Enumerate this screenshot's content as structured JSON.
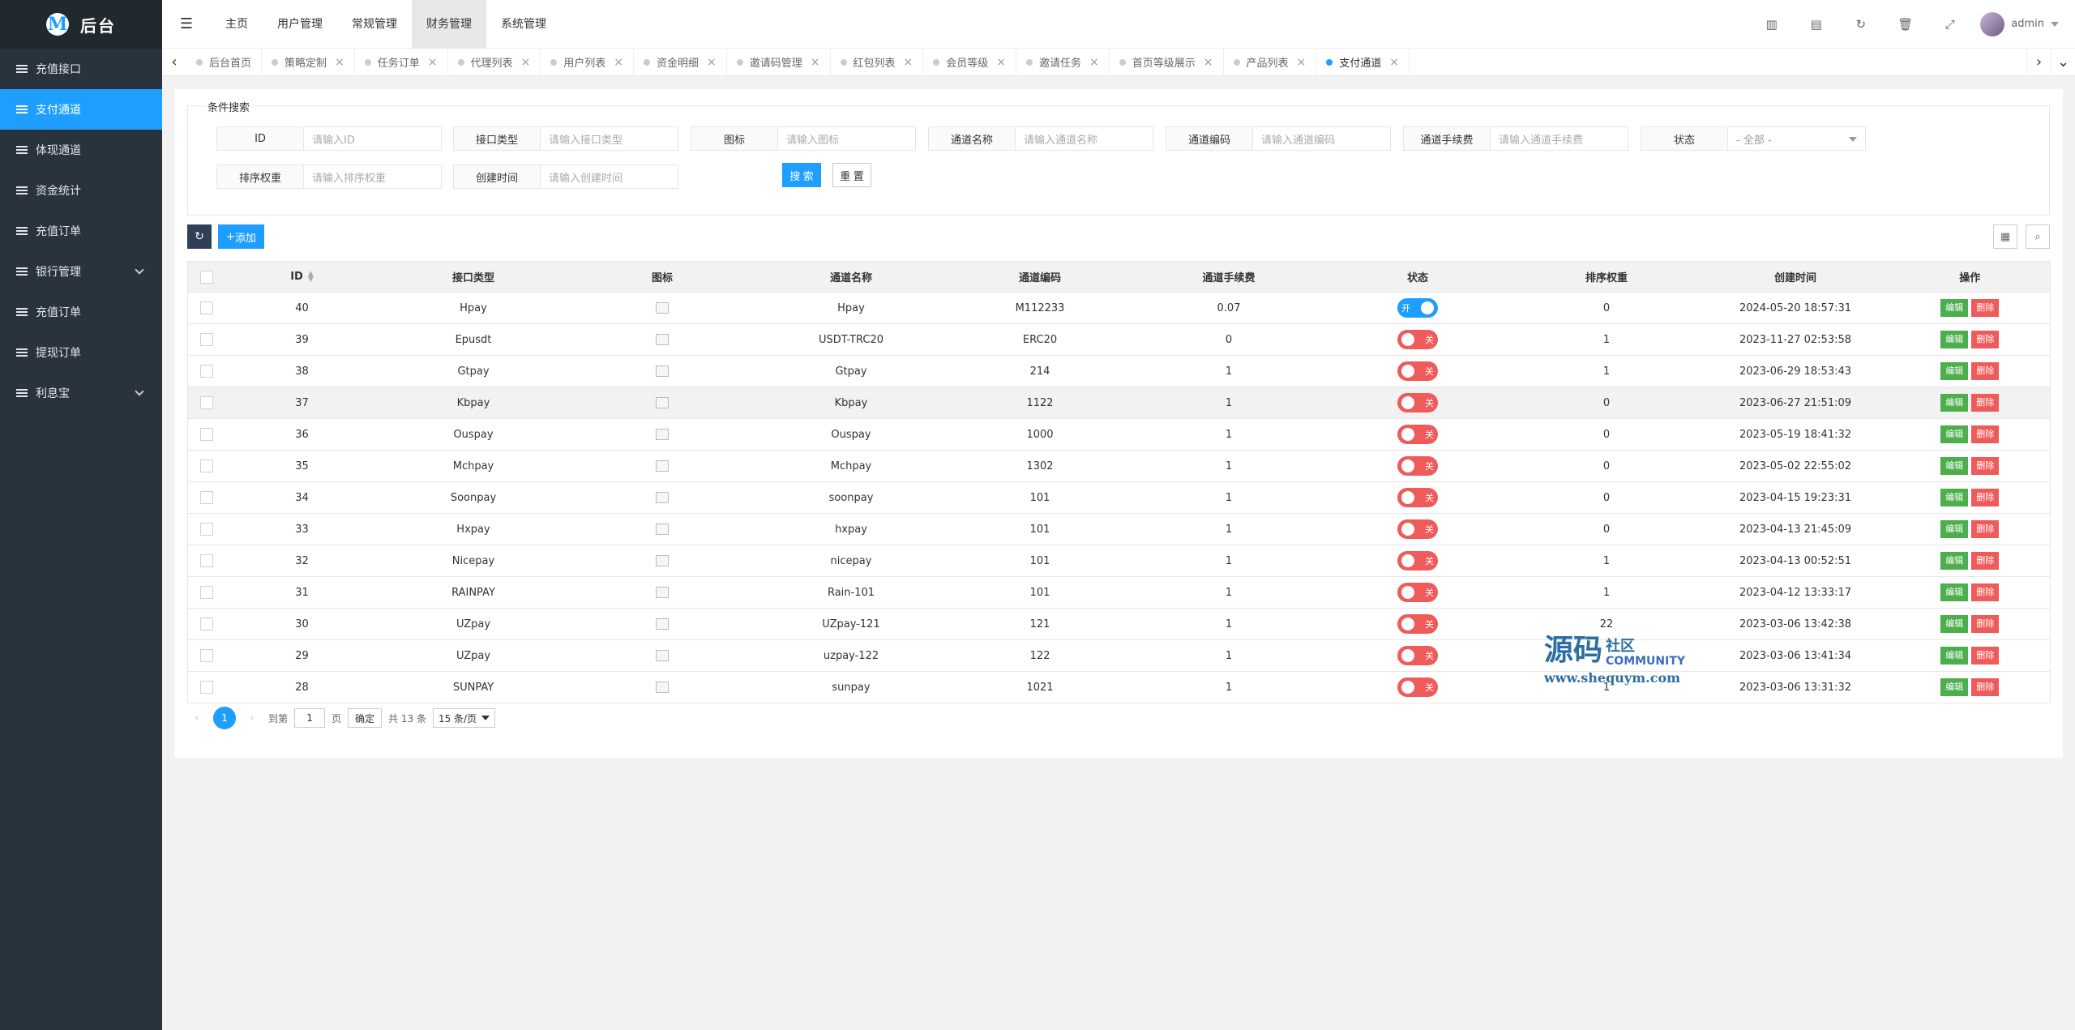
{
  "app": {
    "logo_letter": "M",
    "title": "后台"
  },
  "sidebar": {
    "items": [
      {
        "label": "充值接口",
        "active": false,
        "has_arrow": false
      },
      {
        "label": "支付通道",
        "active": true,
        "has_arrow": false
      },
      {
        "label": "体现通道",
        "active": false,
        "has_arrow": false
      },
      {
        "label": "资金统计",
        "active": false,
        "has_arrow": false
      },
      {
        "label": "充值订单",
        "active": false,
        "has_arrow": false
      },
      {
        "label": "银行管理",
        "active": false,
        "has_arrow": true
      },
      {
        "label": "充值订单",
        "active": false,
        "has_arrow": false
      },
      {
        "label": "提现订单",
        "active": false,
        "has_arrow": false
      },
      {
        "label": "利息宝",
        "active": false,
        "has_arrow": true
      }
    ]
  },
  "header": {
    "nav": [
      "主页",
      "用户管理",
      "常规管理",
      "财务管理",
      "系统管理"
    ],
    "active_nav": 3,
    "username": "admin"
  },
  "tabs": [
    {
      "label": "后台首页",
      "closable": false,
      "active": false
    },
    {
      "label": "策略定制",
      "closable": true,
      "active": false
    },
    {
      "label": "任务订单",
      "closable": true,
      "active": false
    },
    {
      "label": "代理列表",
      "closable": true,
      "active": false
    },
    {
      "label": "用户列表",
      "closable": true,
      "active": false
    },
    {
      "label": "资金明细",
      "closable": true,
      "active": false
    },
    {
      "label": "邀请码管理",
      "closable": true,
      "active": false
    },
    {
      "label": "红包列表",
      "closable": true,
      "active": false
    },
    {
      "label": "会员等级",
      "closable": true,
      "active": false
    },
    {
      "label": "邀请任务",
      "closable": true,
      "active": false
    },
    {
      "label": "首页等级展示",
      "closable": true,
      "active": false
    },
    {
      "label": "产品列表",
      "closable": true,
      "active": false
    },
    {
      "label": "支付通道",
      "closable": true,
      "active": true
    }
  ],
  "search": {
    "legend": "条件搜索",
    "fields": {
      "id": {
        "label": "ID",
        "placeholder": "请输入ID"
      },
      "type": {
        "label": "接口类型",
        "placeholder": "请输入接口类型"
      },
      "icon": {
        "label": "图标",
        "placeholder": "请输入图标"
      },
      "name": {
        "label": "通道名称",
        "placeholder": "请输入通道名称"
      },
      "code": {
        "label": "通道编码",
        "placeholder": "请输入通道编码"
      },
      "fee": {
        "label": "通道手续费",
        "placeholder": "请输入通道手续费"
      },
      "status": {
        "label": "状态",
        "value": "- 全部 -"
      },
      "sort": {
        "label": "排序权重",
        "placeholder": "请输入排序权重"
      },
      "created": {
        "label": "创建时间",
        "placeholder": "请输入创建时间"
      }
    },
    "search_label": "搜 索",
    "reset_label": "重 置"
  },
  "toolbar": {
    "add_label": "添加"
  },
  "table": {
    "headers": [
      "ID",
      "接口类型",
      "图标",
      "通道名称",
      "通道编码",
      "通道手续费",
      "状态",
      "排序权重",
      "创建时间",
      "操作"
    ],
    "edit_label": "编辑",
    "delete_label": "删除",
    "on_label": "开",
    "off_label": "关",
    "rows": [
      {
        "id": "40",
        "type": "Hpay",
        "name": "Hpay",
        "code": "M112233",
        "fee": "0.07",
        "on": true,
        "sort": "0",
        "created": "2024-05-20 18:57:31"
      },
      {
        "id": "39",
        "type": "Epusdt",
        "name": "USDT-TRC20",
        "code": "ERC20",
        "fee": "0",
        "on": false,
        "sort": "1",
        "created": "2023-11-27 02:53:58"
      },
      {
        "id": "38",
        "type": "Gtpay",
        "name": "Gtpay",
        "code": "214",
        "fee": "1",
        "on": false,
        "sort": "1",
        "created": "2023-06-29 18:53:43"
      },
      {
        "id": "37",
        "type": "Kbpay",
        "name": "Kbpay",
        "code": "1122",
        "fee": "1",
        "on": false,
        "sort": "0",
        "created": "2023-06-27 21:51:09"
      },
      {
        "id": "36",
        "type": "Ouspay",
        "name": "Ouspay",
        "code": "1000",
        "fee": "1",
        "on": false,
        "sort": "0",
        "created": "2023-05-19 18:41:32"
      },
      {
        "id": "35",
        "type": "Mchpay",
        "name": "Mchpay",
        "code": "1302",
        "fee": "1",
        "on": false,
        "sort": "0",
        "created": "2023-05-02 22:55:02"
      },
      {
        "id": "34",
        "type": "Soonpay",
        "name": "soonpay",
        "code": "101",
        "fee": "1",
        "on": false,
        "sort": "0",
        "created": "2023-04-15 19:23:31"
      },
      {
        "id": "33",
        "type": "Hxpay",
        "name": "hxpay",
        "code": "101",
        "fee": "1",
        "on": false,
        "sort": "0",
        "created": "2023-04-13 21:45:09"
      },
      {
        "id": "32",
        "type": "Nicepay",
        "name": "nicepay",
        "code": "101",
        "fee": "1",
        "on": false,
        "sort": "1",
        "created": "2023-04-13 00:52:51"
      },
      {
        "id": "31",
        "type": "RAINPAY",
        "name": "Rain-101",
        "code": "101",
        "fee": "1",
        "on": false,
        "sort": "1",
        "created": "2023-04-12 13:33:17"
      },
      {
        "id": "30",
        "type": "UZpay",
        "name": "UZpay-121",
        "code": "121",
        "fee": "1",
        "on": false,
        "sort": "22",
        "created": "2023-03-06 13:42:38"
      },
      {
        "id": "29",
        "type": "UZpay",
        "name": "uzpay-122",
        "code": "122",
        "fee": "1",
        "on": false,
        "sort": "",
        "created": "2023-03-06 13:41:34"
      },
      {
        "id": "28",
        "type": "SUNPAY",
        "name": "sunpay",
        "code": "1021",
        "fee": "1",
        "on": false,
        "sort": "1",
        "created": "2023-03-06 13:31:32"
      }
    ]
  },
  "pager": {
    "current": "1",
    "goto_label": "到第",
    "goto_value": "1",
    "page_suffix": "页",
    "confirm_label": "确定",
    "total_label": "共 13 条",
    "limit_label": "15 条/页"
  },
  "watermark": {
    "big": "源码",
    "small_top": "社区",
    "small_bottom": "COMMUNITY",
    "url": "www.shequym.com"
  }
}
